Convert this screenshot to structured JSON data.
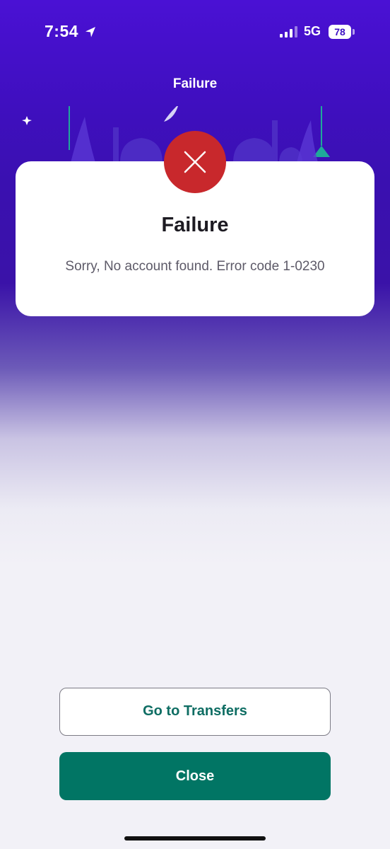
{
  "status_bar": {
    "time": "7:54",
    "network": "5G",
    "battery": "78"
  },
  "header": {
    "title": "Failure"
  },
  "dialog": {
    "title": "Failure",
    "message": "Sorry, No account found. Error code 1-0230",
    "icon": "close-x-icon"
  },
  "actions": {
    "go_to_transfers": "Go to Transfers",
    "close": "Close"
  },
  "colors": {
    "header_purple": "#4a11d4",
    "error_red": "#c8282c",
    "primary_green": "#017564",
    "link_green": "#0e6d63"
  }
}
